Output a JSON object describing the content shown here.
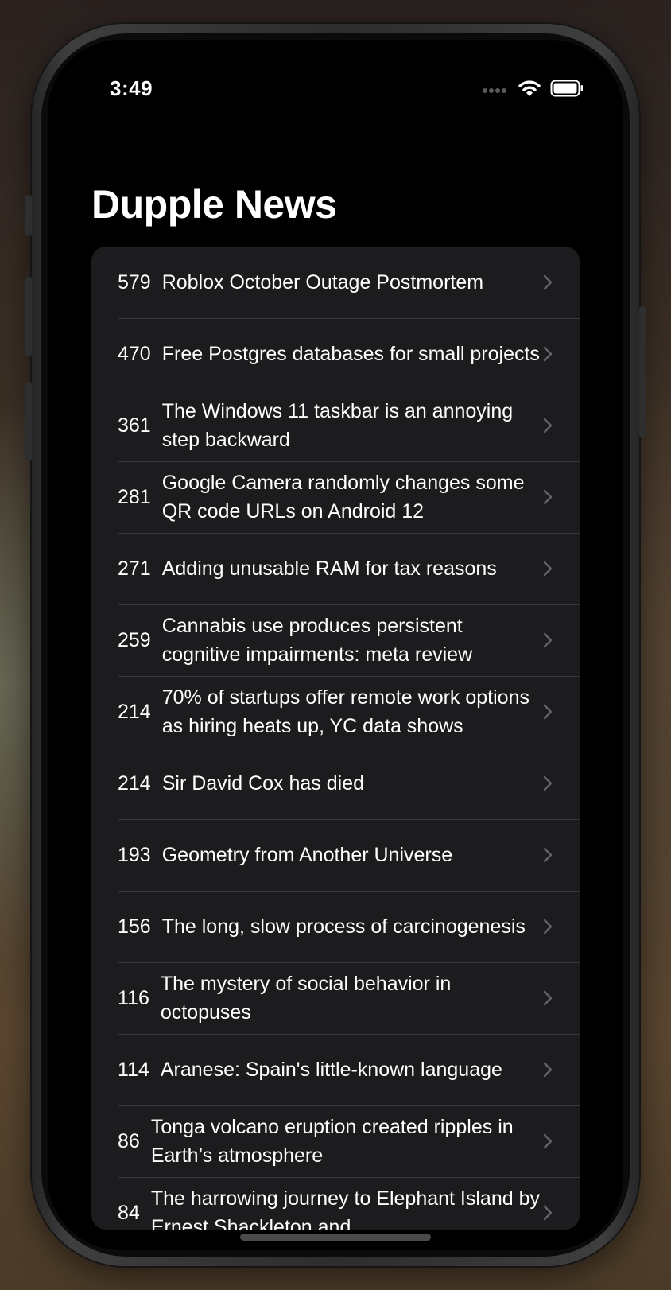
{
  "status_bar": {
    "time": "3:49"
  },
  "app": {
    "title": "Dupple News"
  },
  "stories": [
    {
      "points": "579",
      "title": "Roblox October Outage Postmortem"
    },
    {
      "points": "470",
      "title": "Free Postgres databases for small projects"
    },
    {
      "points": "361",
      "title": "The Windows 11 taskbar is an annoying step backward"
    },
    {
      "points": "281",
      "title": "Google Camera randomly changes some QR code URLs on Android 12"
    },
    {
      "points": "271",
      "title": "Adding unusable RAM for tax reasons"
    },
    {
      "points": "259",
      "title": "Cannabis use produces persistent cognitive impairments: meta review"
    },
    {
      "points": "214",
      "title": "70% of startups offer remote work options as hiring heats up, YC data shows"
    },
    {
      "points": "214",
      "title": "Sir David Cox has died"
    },
    {
      "points": "193",
      "title": "Geometry from Another Universe"
    },
    {
      "points": "156",
      "title": "The long, slow process of carcinogenesis"
    },
    {
      "points": "116",
      "title": "The mystery of social behavior in octopuses"
    },
    {
      "points": "114",
      "title": "Aranese: Spain's little-known language"
    },
    {
      "points": "86",
      "title": "Tonga volcano eruption created ripples in Earth’s atmosphere"
    },
    {
      "points": "84",
      "title": "The harrowing journey to Elephant Island by Ernest Shackleton and"
    }
  ],
  "icons": {
    "row_disclosure": "chevron-right-icon",
    "signal": "cellular-signal-icon",
    "wifi": "wifi-icon",
    "battery": "battery-icon"
  },
  "colors": {
    "background": "#000000",
    "list_background": "#1c1c1e",
    "separator": "#38383a",
    "text": "#ffffff",
    "chevron": "#636366"
  }
}
